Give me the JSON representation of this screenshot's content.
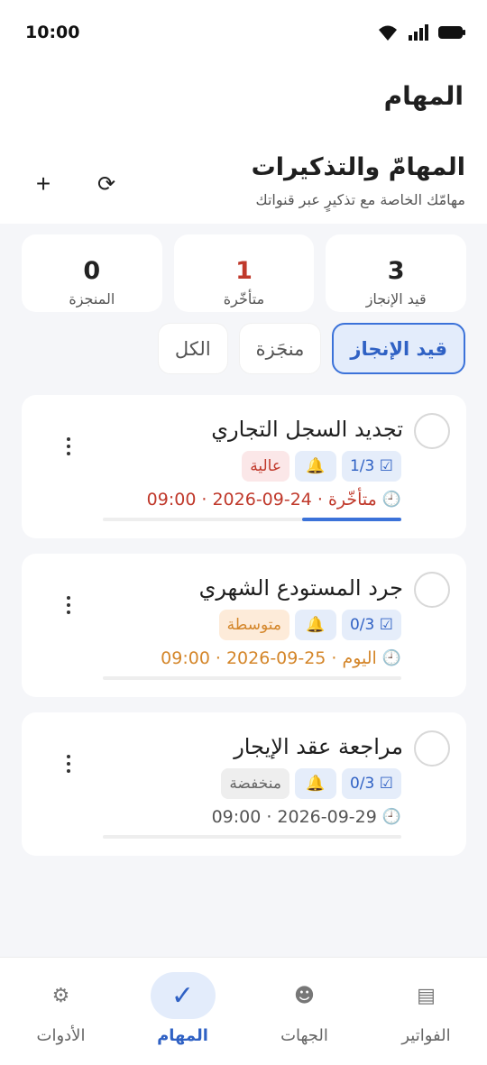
{
  "status_bar": {
    "time": "10:00"
  },
  "app_bar": {
    "title": "المهام"
  },
  "header": {
    "title": "المهامّ والتذكيرات",
    "subtitle": "مهامّك الخاصة مع تذكيرٍ عبر قنواتك",
    "add_icon": "+",
    "refresh_icon": "⟳"
  },
  "stats": [
    {
      "value": "3",
      "label": "قيد الإنجاز"
    },
    {
      "value": "1",
      "label": "متأخّرة"
    },
    {
      "value": "0",
      "label": "المنجزة"
    }
  ],
  "filters": [
    {
      "label": "قيد الإنجاز",
      "active": true
    },
    {
      "label": "منجَزة",
      "active": false
    },
    {
      "label": "الكل",
      "active": false
    }
  ],
  "tasks": [
    {
      "title": "تجديد السجل التجاري",
      "subtasks": "☑ 1/3",
      "bell": "🔔",
      "priority": "عالية",
      "status": "متأخّرة",
      "date": "2026-09-24",
      "time": "09:00",
      "progress": 0.333
    },
    {
      "title": "جرد المستودع الشهري",
      "subtasks": "☑ 0/3",
      "bell": "🔔",
      "priority": "متوسطة",
      "status": "اليوم",
      "date": "2026-09-25",
      "time": "09:00",
      "progress": 0
    },
    {
      "title": "مراجعة عقد الإيجار",
      "subtasks": "☑ 0/3",
      "bell": "🔔",
      "priority": "منخفضة",
      "date": "2026-09-29",
      "time": "09:00",
      "progress": 0
    }
  ],
  "nav": [
    {
      "label": "الفواتير",
      "icon": "▤"
    },
    {
      "label": "الجهات",
      "icon": "☻"
    },
    {
      "label": "المهام",
      "icon": "✓",
      "active": true
    },
    {
      "label": "الأدوات",
      "icon": "⚙"
    }
  ],
  "colors": {
    "accent": "#3b72d9",
    "overdue": "#c0392b",
    "today": "#d4862a",
    "background": "#f5f6f9"
  },
  "icons": {
    "clock": "🕘",
    "separator": "·"
  }
}
